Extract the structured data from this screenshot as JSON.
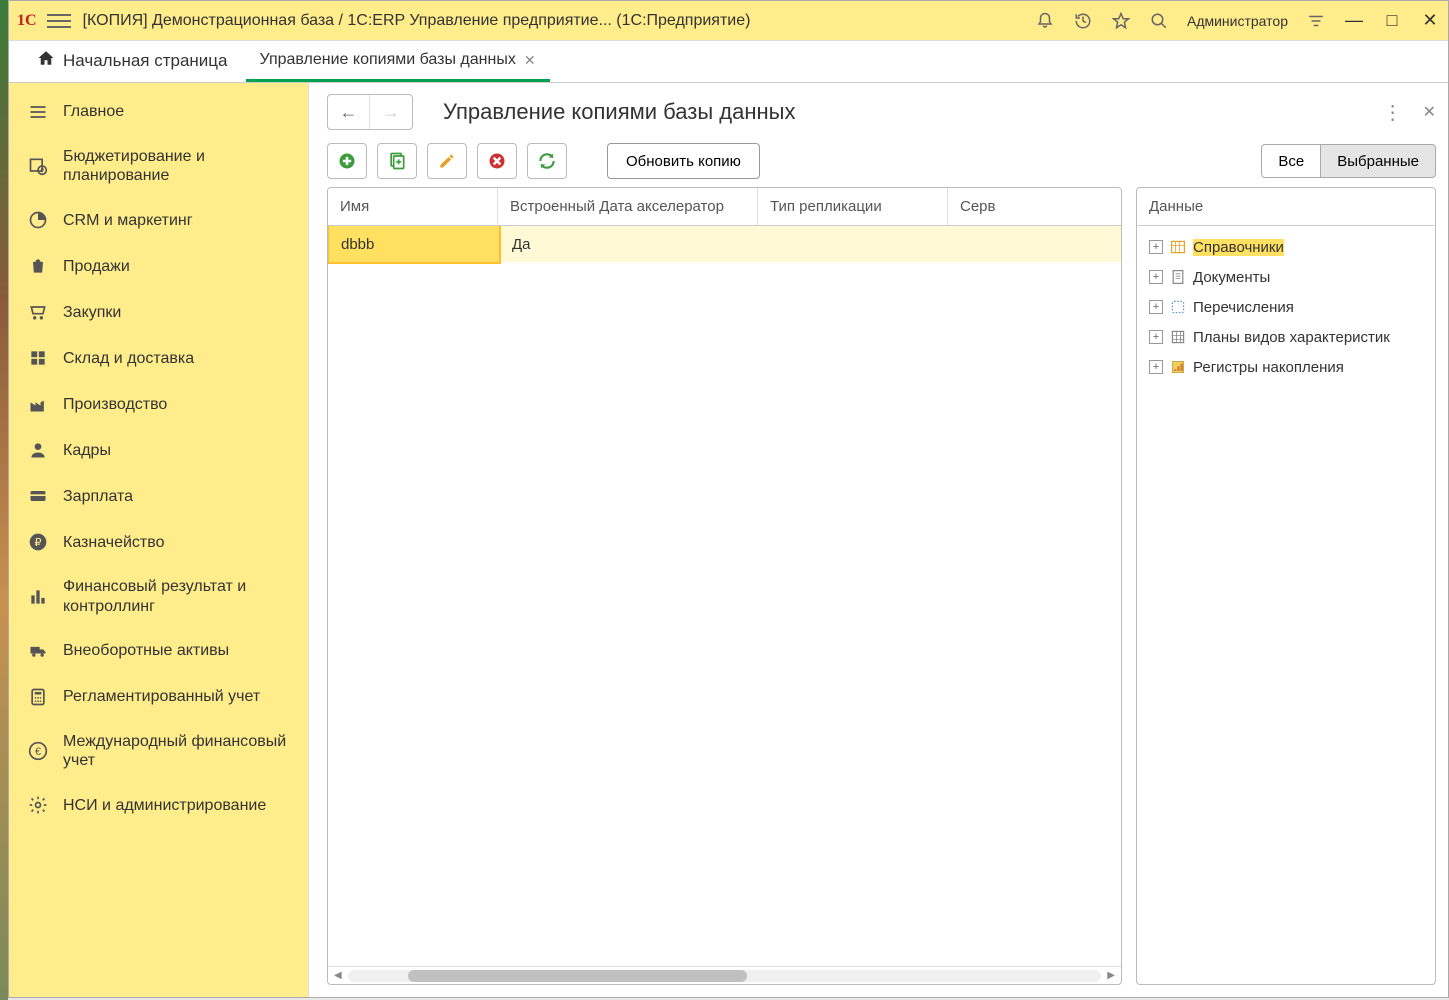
{
  "titlebar": {
    "app_title": "[КОПИЯ] Демонстрационная база / 1С:ERP Управление предприятие... (1С:Предприятие)",
    "user": "Администратор",
    "logo": "1С"
  },
  "tabs": {
    "home_label": "Начальная страница",
    "items": [
      {
        "label": "Управление копиями базы данных",
        "active": true
      }
    ]
  },
  "sidebar": {
    "items": [
      {
        "label": "Главное",
        "icon": "hamburger"
      },
      {
        "label": "Бюджетирование и планирование",
        "icon": "budget"
      },
      {
        "label": "CRM и маркетинг",
        "icon": "clock"
      },
      {
        "label": "Продажи",
        "icon": "bag"
      },
      {
        "label": "Закупки",
        "icon": "cart"
      },
      {
        "label": "Склад и доставка",
        "icon": "grid"
      },
      {
        "label": "Производство",
        "icon": "factory"
      },
      {
        "label": "Кадры",
        "icon": "person"
      },
      {
        "label": "Зарплата",
        "icon": "card"
      },
      {
        "label": "Казначейство",
        "icon": "ruble"
      },
      {
        "label": "Финансовый результат и контроллинг",
        "icon": "chart"
      },
      {
        "label": "Внеоборотные активы",
        "icon": "truck"
      },
      {
        "label": "Регламентированный учет",
        "icon": "calc"
      },
      {
        "label": "Международный финансовый учет",
        "icon": "euro"
      },
      {
        "label": "НСИ и администрирование",
        "icon": "gear"
      }
    ]
  },
  "workspace": {
    "title": "Управление копиями базы данных",
    "toolbar": {
      "update_btn": "Обновить копию",
      "filter_all": "Все",
      "filter_selected": "Выбранные"
    },
    "table": {
      "columns": [
        "Имя",
        "Встроенный Дата акселератор",
        "Тип репликации",
        "Серв"
      ],
      "rows": [
        {
          "name": "dbbb",
          "builtin": "Да",
          "replication": "",
          "server": ""
        }
      ]
    },
    "data_panel": {
      "header": "Данные",
      "tree": [
        {
          "label": "Справочники",
          "icon": "catalog",
          "highlighted": true
        },
        {
          "label": "Документы",
          "icon": "doc",
          "highlighted": false
        },
        {
          "label": "Перечисления",
          "icon": "enum",
          "highlighted": false
        },
        {
          "label": "Планы видов характеристик",
          "icon": "plan",
          "highlighted": false
        },
        {
          "label": "Регистры накопления",
          "icon": "register",
          "highlighted": false
        }
      ]
    }
  }
}
